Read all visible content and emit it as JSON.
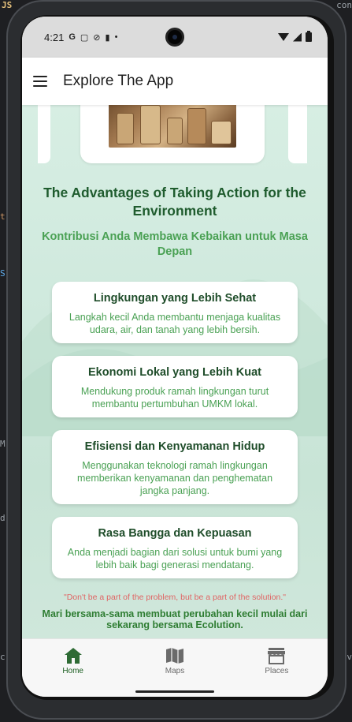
{
  "status_bar": {
    "time": "4:21",
    "icons": [
      "google-icon",
      "screenshot-icon",
      "shield-icon",
      "sdcard-icon",
      "dot-icon"
    ],
    "right_icons": [
      "wifi-icon",
      "signal-icon",
      "battery-icon"
    ]
  },
  "app_bar": {
    "menu_icon": "hamburger-menu-icon",
    "title": "Explore The App"
  },
  "section": {
    "title": "The Advantages of Taking Action for the Environment",
    "subtitle": "Kontribusi Anda Membawa Kebaikan untuk Masa Depan"
  },
  "cards": [
    {
      "title": "Lingkungan yang Lebih Sehat",
      "text": "Langkah kecil Anda membantu menjaga kualitas udara, air, dan tanah yang lebih bersih."
    },
    {
      "title": "Ekonomi Lokal yang Lebih Kuat",
      "text": "Mendukung produk ramah lingkungan turut membantu pertumbuhan UMKM lokal."
    },
    {
      "title": "Efisiensi dan Kenyamanan Hidup",
      "text": "Menggunakan teknologi ramah lingkungan memberikan kenyamanan dan penghematan jangka panjang."
    },
    {
      "title": "Rasa Bangga dan Kepuasan",
      "text": "Anda menjadi bagian dari solusi untuk bumi yang lebih baik bagi generasi mendatang."
    }
  ],
  "quote": "\"Don't be a part of the problem, but be a part of the solution.\"",
  "closing": "Mari bersama-sama membuat perubahan kecil mulai dari sekarang bersama Ecolution.",
  "bottom_nav": [
    {
      "label": "Home",
      "icon": "home-icon",
      "active": true
    },
    {
      "label": "Maps",
      "icon": "map-icon",
      "active": false
    },
    {
      "label": "Places",
      "icon": "store-icon",
      "active": false
    }
  ],
  "colors": {
    "primary_green": "#1f5c2e",
    "accent_green": "#4aa154",
    "quote_red": "#e06565",
    "nav_active": "#1b5e20"
  },
  "background_editor": {
    "file_label": "JS",
    "fragments": [
      "t",
      "S",
      "M",
      "d",
      "c",
      "con",
      "iv"
    ]
  }
}
